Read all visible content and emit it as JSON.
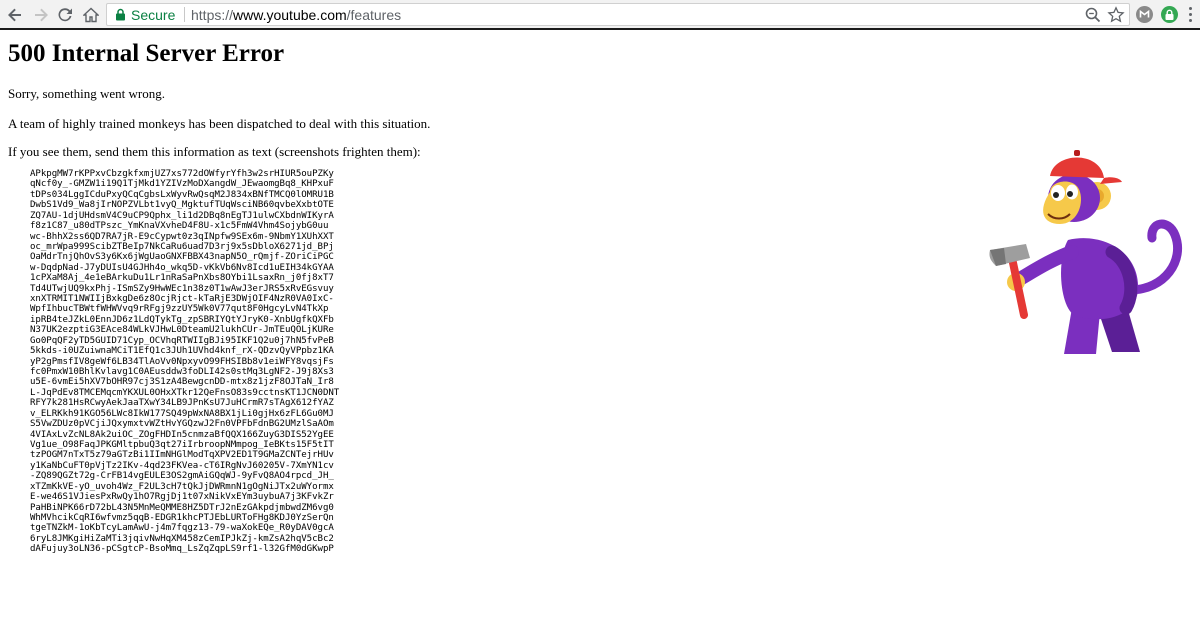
{
  "browser": {
    "secure_label": "Secure",
    "url": {
      "scheme": "https://",
      "host": "www.youtube.com",
      "path": "/features"
    },
    "icons": {
      "back": "arrow-left-icon",
      "forward": "arrow-right-icon",
      "reload": "reload-icon",
      "home": "home-icon",
      "lock": "lock-icon",
      "zoom": "magnifier-icon",
      "bookmark": "star-icon",
      "extension1": "extension-gray-icon",
      "extension2": "extension-green-lock-icon",
      "menu": "more-vertical-icon"
    },
    "colors": {
      "secure": "#0b8043",
      "ext_green": "#34a853"
    }
  },
  "page": {
    "heading": "500 Internal Server Error",
    "message1": "Sorry, something went wrong.",
    "message2": "A team of highly trained monkeys has been dispatched to deal with this situation.",
    "message3": "If you see them, send them this information as text (screenshots frighten them):",
    "debug_lines": [
      "APkpgMW7rKPPxvCbzgkfxmjUZ7xs772dOWfyrYfh3w2srHIUR5ouPZKy",
      "qNcf0y_-GMZW1i19Q1TjMkd1YZIVzMoDXangdW_JEwaomgBq8_KHPxuF",
      "tDPs034LggICduPxyQCqCgbsLxWyvRwQsqM2J834xBNfTMCQ0lOMRU1B",
      "DwbS1Vd9_Wa8jIrNOPZVLbt1vyQ_MgktufTUqWsciNB60qvbeXxbtOTE",
      "ZQ7AU-1djUHdsmV4C9uCP9Qphx_li1d2DBq8nEgTJ1ulwCXbdnWIKyrA",
      "f8z1C87_u80dTPszc_YmKnaVXvheD4F8U-x1c5FmW4Vhm4SojybG0uu",
      "wc-BhhX2ss6QD7RA7jR-E9cCypwt0z3qINpfw9SEx6m-9NbmY1XUhXXT",
      "oc_mrWpa999ScibZTBeIp7NkCaRu6uad7D3rj9x5sDbloX6271jd_BPj",
      "OaMdrTnjQhOvS3y6Kx6jWgUaoGNXFBBX43napN5O_rQmjf-ZOriCiPGC",
      "w-DqdpNad-J7yDUIsU4GJHh4o_wkq5D-vKkVb6Nv8Icd1uEIH34kGYAA",
      "1cPXaM8Aj_4e1eBArkuDu1Lr1nRaSaPnXbs8OYbi1LsaxRn_j0fj8xT7",
      "Td4UTwjUQ9kxPhj-ISmSZy9HwWEc1n38z0T1wAwJ3erJRS5xRvEGsvuy",
      "xnXTRMIT1NWIIjBxkgDe6z8OcjRjct-kTaRjE3DWjOIF4NzR0VA0IxC-",
      "WpfIhbucTBWtfWHWVvq9rRFgj9zzUY5Wk0V77qut8F0HgcyLvN4TkXp",
      "ipRB4teJZkL0EnnJD6z1LdQTykTg_zpSBRIYQtYJryK0-XnbUgfkQXFb",
      "N37UK2ezptiG3EAce84WLkVJHwL0DteamU2lukhCUr-JmTEuQOLjKURe",
      "Go0PqQF2yTD5GUID71Cyp_OCVhqRTWIIgBJi95IKF1Q2u0j7hN5fvPeB",
      "5kkds-i0UZuiwnaMCiT1EfQ1c3JUh1UVhd4knf_rX-QDzvQyVPpbz1KA",
      "yP2gPmsfIV8geWf6LB34TlAoVv0NpxyvO99FHSIBb8v1eiWFY8vqsjFs",
      "fc0PmxW10BhlKvlavg1C0AEusddw3foDLI42s0stMq3LgNF2-J9j8Xs3",
      "u5E-6vmEi5hXV7bOHR97cj3S1zA4BewgcnDD-mtx8z1jzF8OJTaN_Ir8",
      "L-JqPdEv8TMCEMqcmYKXUL0OHxXTkr12QeFnsO83s9cctnsKT1JCN0DNT",
      "RFY7k281HsRCwyAekJaaTXwY34LB9JPnKsU7JuHCrmR7sTAgX612fYAZ",
      "v_ELRKkh91KGO56LWc8IkW177SQ49pWxNA8BX1jLi0gjHx6zFL6Gu0MJ",
      "S5VwZDUz0pVCjiJQxymxtvWZtHvYGQzwJ2Fn0VPFbFdnBG2UMzlSaAOm",
      "4VIAxLvZcNL8Ak2uiOC_ZOgFHDIn5cnmzaBfQQX166ZuyG3DIS52YgEE",
      "Vg1ue_O98FaqJPKGMltpbuQ3qt27iIrbroopNMmpog_IeBKts15F5tIT",
      "tzPOGM7nTxT5z79aGTzBi1IImNHGlModTqXPV2ED1T9GMaZCNTejrHUv",
      "y1KaNbCuFT0pVjTz2IKv-4qd23FKVea-cT6IRgNvJ60205V-7XmYN1cv",
      "-ZQ89QGZt72g-CrFB14vgEULE3OS2gmAiGQqWJ-9yFvQ8AO4rpcd_JH_",
      "xTZmKkVE-yO_uvoh4Wz_F2UL3cH7tQkJjDWRmnN1gOgNiJTx2uWYormx",
      "E-we46S1VJiesPxRwQy1hO7RgjDj1t07xNikVxEYm3uybuA7j3KFvkZr",
      "PaHBiNPK66rD72bL43N5MnMeQMME8HZ5DTrJ2nEzGAkpdjmbwdZM6vg0",
      "WhMVhcikCqRI6wfvmz5qqB-EDGR1khcPTJEbLURToFHg8KDJ0YzSerQn",
      "tgeTNZkM-1oKbTcyLamAwU-j4m7fqgz13-79-waXokEQe_R0yDAV0gcA",
      "6ryL8JMKgiHiZaMTi3jqivNwHqXM458zCemIPJkZj-kmZsA2hqV5cBc2",
      "dAFujuy3oLN36-pCSgtcP-BsoMmq_LsZqZqpLS9rf1-l32GfM0dGKwpP"
    ]
  },
  "illustration": {
    "name": "monkey-with-hammer",
    "colors": {
      "fur": "#7b2fbf",
      "fur_dark": "#5b1f96",
      "face": "#f6c94a",
      "cap": "#e53935",
      "hammer_handle": "#e53935",
      "hammer_head": "#9e9e9e"
    }
  }
}
